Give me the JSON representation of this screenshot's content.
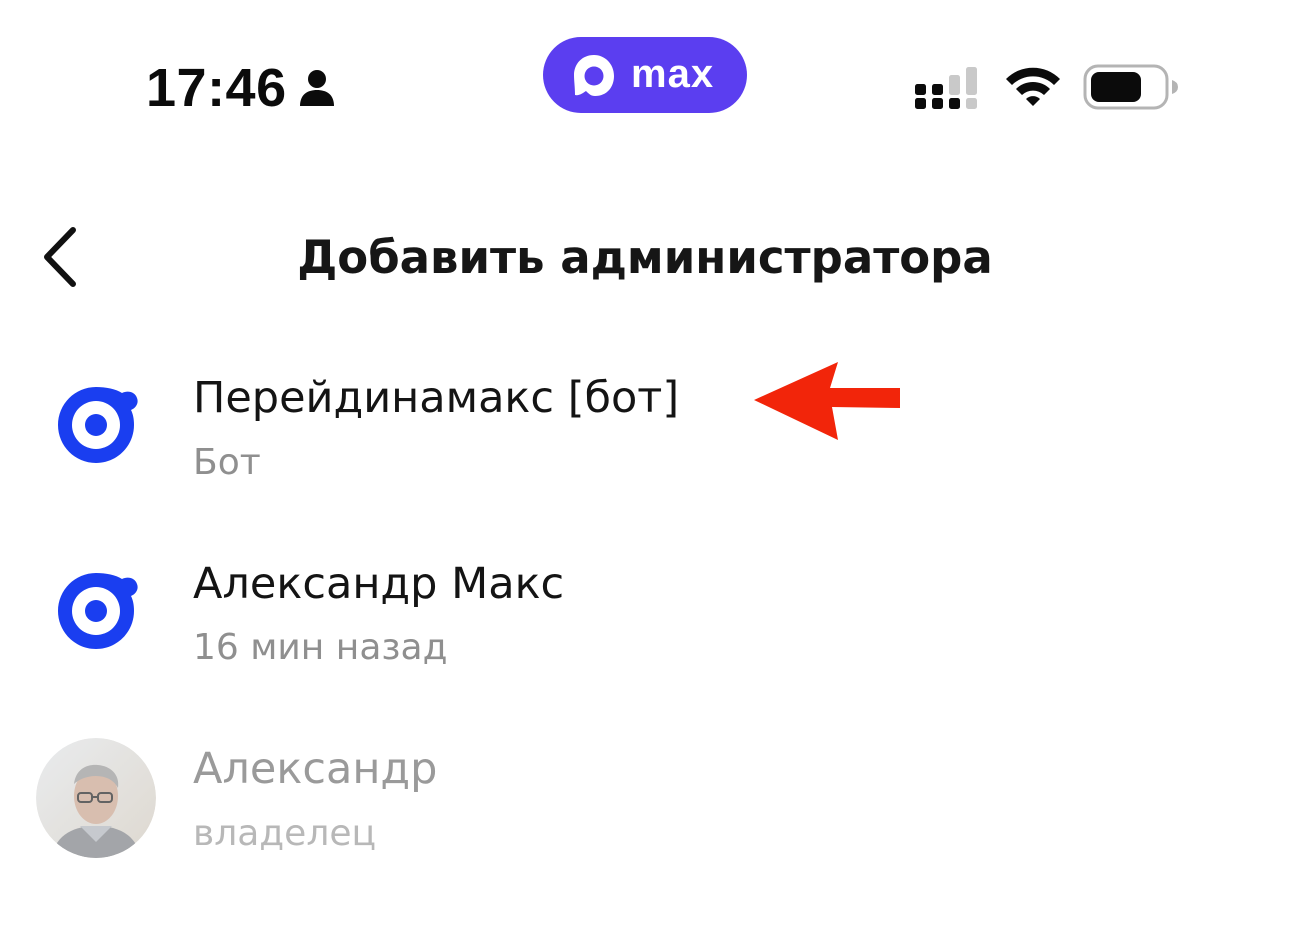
{
  "status_bar": {
    "time": "17:46",
    "brand": {
      "name": "max",
      "color": "#5b3ef0"
    },
    "icons": [
      "person-icon",
      "signal-icon",
      "wifi-icon",
      "battery-icon"
    ]
  },
  "header": {
    "back_icon": "chevron-left-icon",
    "title": "Добавить администратора"
  },
  "list": {
    "items": [
      {
        "name": "Перейдинамакс [бот]",
        "subtitle": "Бот",
        "avatar": "bot-logo-icon",
        "highlighted_by_arrow": true
      },
      {
        "name": "Александр Макс",
        "subtitle": "16 мин назад",
        "avatar": "bot-logo-icon",
        "highlighted_by_arrow": false
      },
      {
        "name": "Александр",
        "subtitle": "владелец",
        "avatar": "user-photo",
        "disabled": true
      }
    ]
  },
  "annotation": {
    "arrow_icon": "red-arrow-icon",
    "arrow_color": "#f2250a"
  },
  "colors": {
    "bot_logo": "#1a3ef0",
    "title_text": "#161616",
    "secondary_text": "#8f8f8f",
    "disabled_text": "#9a9a9a"
  }
}
